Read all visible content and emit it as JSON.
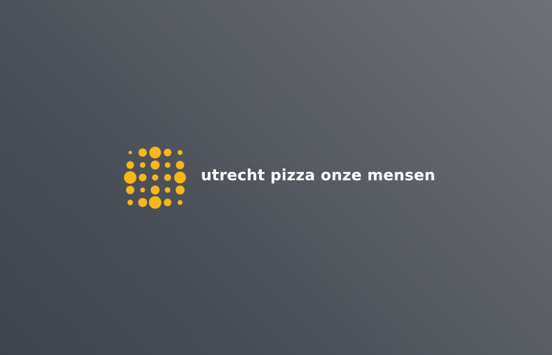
{
  "brand": {
    "name": "utrecht pizza onze mensen",
    "logo_icon": "dot-grid-logo-icon",
    "accent_color": "#f7b719",
    "text_color": "#ffffff"
  },
  "logo_dots_cols": [
    [
      2.5,
      5.5,
      9,
      6,
      4
    ],
    [
      6,
      4,
      5.5,
      3.5,
      6.5
    ],
    [
      8.5,
      6.5,
      4.5,
      6.5,
      9
    ],
    [
      5.5,
      4,
      5,
      4,
      5.5
    ],
    [
      3.5,
      6,
      8.5,
      6.5,
      3.5
    ]
  ]
}
